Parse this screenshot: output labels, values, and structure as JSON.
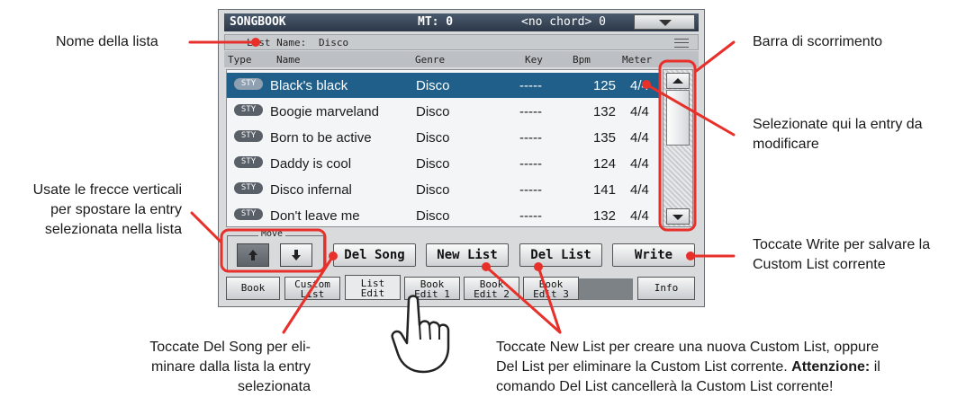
{
  "screen": {
    "title": "SONGBOOK",
    "mt": "MT: 0",
    "chord": "<no chord> 0",
    "list_name_label": "List Name:",
    "list_name_value": "Disco",
    "columns": [
      "Type",
      "Name",
      "Genre",
      "Key",
      "Bpm",
      "Meter"
    ],
    "rows": [
      {
        "type": "STY",
        "name": "Black's black",
        "genre": "Disco",
        "key": "-----",
        "bpm": "125",
        "meter": "4/4",
        "selected": true
      },
      {
        "type": "STY",
        "name": "Boogie marveland",
        "genre": "Disco",
        "key": "-----",
        "bpm": "132",
        "meter": "4/4",
        "selected": false
      },
      {
        "type": "STY",
        "name": "Born to be active",
        "genre": "Disco",
        "key": "-----",
        "bpm": "135",
        "meter": "4/4",
        "selected": false
      },
      {
        "type": "STY",
        "name": "Daddy is cool",
        "genre": "Disco",
        "key": "-----",
        "bpm": "124",
        "meter": "4/4",
        "selected": false
      },
      {
        "type": "STY",
        "name": "Disco infernal",
        "genre": "Disco",
        "key": "-----",
        "bpm": "141",
        "meter": "4/4",
        "selected": false
      },
      {
        "type": "STY",
        "name": "Don't leave me",
        "genre": "Disco",
        "key": "-----",
        "bpm": "132",
        "meter": "4/4",
        "selected": false
      }
    ],
    "move_label": "Move",
    "buttons": {
      "del_song": "Del Song",
      "new_list": "New List",
      "del_list": "Del List",
      "write": "Write"
    },
    "tabs": [
      {
        "line1": "Book",
        "line2": ""
      },
      {
        "line1": "Custom",
        "line2": "List"
      },
      {
        "line1": "List",
        "line2": "Edit"
      },
      {
        "line1": "Book",
        "line2": "Edit 1"
      },
      {
        "line1": "Book",
        "line2": "Edit 2"
      },
      {
        "line1": "Book",
        "line2": "Edit 3"
      },
      {
        "line1": "Info",
        "line2": ""
      }
    ],
    "active_tab": "List Edit",
    "selection_color": "#1f5f8a",
    "title_bar_color": "#2c3848"
  },
  "annotations": {
    "list_name": "Nome della lista",
    "scrollbar": "Barra di scorrimento",
    "select_entry_1": "Selezionate qui la entry da",
    "select_entry_2": "modificare",
    "arrows_1": "Usate le frecce verticali",
    "arrows_2": "per spostare la entry",
    "arrows_3": "selezionata nella lista",
    "write_1": "Toccate Write per salvare la",
    "write_2": "Custom List corrente",
    "del_song_1": "Toccate Del Song per eli-",
    "del_song_2": "minare dalla lista la entry",
    "del_song_3": "selezionata",
    "new_list_1": "Toccate New List per creare una nuova Custom List, oppure",
    "new_list_2a": "Del List per eliminare la Custom List corrente.",
    "new_list_2b": "Attenzione:",
    "new_list_2c": "il",
    "new_list_3": "comando Del List cancellerà la Custom List corrente!",
    "callout_color": "#e8302b"
  }
}
